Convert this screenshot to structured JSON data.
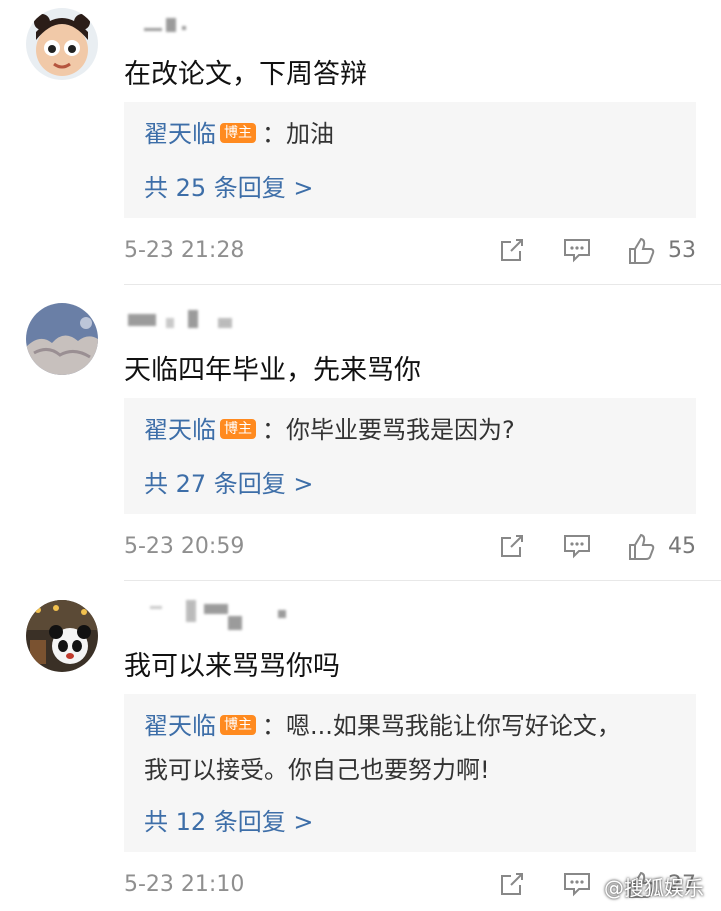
{
  "comments": [
    {
      "text": "在改论文，下周答辩",
      "reply": {
        "author": "翟天临",
        "badge": "博主",
        "lines": [
          "：加油"
        ],
        "count_label": "共 25 条回复 >"
      },
      "time": "5-23 21:28",
      "likes": "53"
    },
    {
      "text": "天临四年毕业，先来骂你",
      "reply": {
        "author": "翟天临",
        "badge": "博主",
        "lines": [
          "：你毕业要骂我是因为?"
        ],
        "count_label": "共 27 条回复 >"
      },
      "time": "5-23 20:59",
      "likes": "45"
    },
    {
      "text": "我可以来骂骂你吗",
      "reply": {
        "author": "翟天临",
        "badge": "博主",
        "lines": [
          "：嗯...如果骂我能让你写好论文，",
          "我可以接受。你自己也要努力啊!"
        ],
        "count_label": "共 12 条回复 >"
      },
      "time": "5-23 21:10",
      "likes": "27"
    }
  ],
  "watermark": "@搜狐娱乐",
  "colors": {
    "link": "#3d6ea8",
    "badge": "#ff8a1f",
    "reply_bg": "#f6f6f6"
  }
}
